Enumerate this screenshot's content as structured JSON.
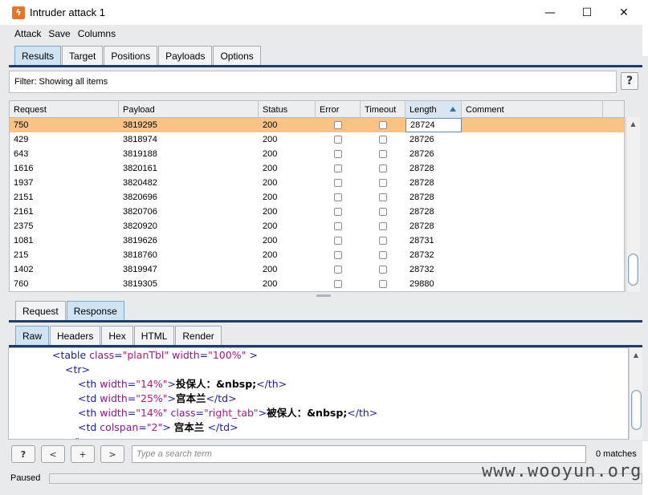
{
  "window": {
    "title": "Intruder attack 1",
    "controls": {
      "minimize": "—",
      "maximize": "☐",
      "close": "✕"
    }
  },
  "menu": [
    "Attack",
    "Save",
    "Columns"
  ],
  "main_tabs": [
    {
      "label": "Results",
      "active": true
    },
    {
      "label": "Target",
      "active": false
    },
    {
      "label": "Positions",
      "active": false
    },
    {
      "label": "Payloads",
      "active": false
    },
    {
      "label": "Options",
      "active": false
    }
  ],
  "filter": {
    "text": "Filter:  Showing all items",
    "help": "?"
  },
  "results_table": {
    "columns": [
      "Request",
      "Payload",
      "Status",
      "Error",
      "Timeout",
      "Length",
      "Comment"
    ],
    "sorted_column": "Length",
    "selected_row": 0,
    "rows": [
      {
        "request": "750",
        "payload": "3819295",
        "status": "200",
        "length": "28724"
      },
      {
        "request": "429",
        "payload": "3818974",
        "status": "200",
        "length": "28726"
      },
      {
        "request": "643",
        "payload": "3819188",
        "status": "200",
        "length": "28726"
      },
      {
        "request": "1616",
        "payload": "3820161",
        "status": "200",
        "length": "28728"
      },
      {
        "request": "1937",
        "payload": "3820482",
        "status": "200",
        "length": "28728"
      },
      {
        "request": "2151",
        "payload": "3820696",
        "status": "200",
        "length": "28728"
      },
      {
        "request": "2161",
        "payload": "3820706",
        "status": "200",
        "length": "28728"
      },
      {
        "request": "2375",
        "payload": "3820920",
        "status": "200",
        "length": "28728"
      },
      {
        "request": "1081",
        "payload": "3819626",
        "status": "200",
        "length": "28731"
      },
      {
        "request": "215",
        "payload": "3818760",
        "status": "200",
        "length": "28732"
      },
      {
        "request": "1402",
        "payload": "3819947",
        "status": "200",
        "length": "28732"
      },
      {
        "request": "760",
        "payload": "3819305",
        "status": "200",
        "length": "29880"
      }
    ]
  },
  "detail_tabs": [
    {
      "label": "Request",
      "active": false
    },
    {
      "label": "Response",
      "active": true
    }
  ],
  "view_tabs": [
    {
      "label": "Raw",
      "active": true
    },
    {
      "label": "Headers",
      "active": false
    },
    {
      "label": "Hex",
      "active": false
    },
    {
      "label": "HTML",
      "active": false
    },
    {
      "label": "Render",
      "active": false
    }
  ],
  "code_lines": [
    {
      "indent": 54,
      "tokens": [
        [
          "tg",
          "<table "
        ],
        [
          "an",
          "class"
        ],
        [
          "tg",
          "="
        ],
        [
          "av",
          "\"planTbl\""
        ],
        [
          "tg",
          " "
        ],
        [
          "an",
          "width"
        ],
        [
          "tg",
          "="
        ],
        [
          "av",
          "\"100%\""
        ],
        [
          "tg",
          " >"
        ]
      ]
    },
    {
      "indent": 70,
      "tokens": [
        [
          "tg",
          "<tr>"
        ]
      ]
    },
    {
      "indent": 86,
      "tokens": [
        [
          "tg",
          "<th "
        ],
        [
          "an",
          "width"
        ],
        [
          "tg",
          "="
        ],
        [
          "av",
          "\"14%\""
        ],
        [
          "tg",
          ">"
        ],
        [
          "tx",
          "投保人：&nbsp;"
        ],
        [
          "tg",
          "</th>"
        ]
      ]
    },
    {
      "indent": 86,
      "tokens": [
        [
          "tg",
          "<td "
        ],
        [
          "an",
          "width"
        ],
        [
          "tg",
          "="
        ],
        [
          "av",
          "\"25%\""
        ],
        [
          "tg",
          ">"
        ],
        [
          "tx",
          "宫本兰"
        ],
        [
          "tg",
          "</td>"
        ]
      ]
    },
    {
      "indent": 86,
      "tokens": [
        [
          "tg",
          "<th "
        ],
        [
          "an",
          "width"
        ],
        [
          "tg",
          "="
        ],
        [
          "av",
          "\"14%\""
        ],
        [
          "tg",
          " "
        ],
        [
          "an",
          "class"
        ],
        [
          "tg",
          "="
        ],
        [
          "av",
          "\"right_tab\""
        ],
        [
          "tg",
          ">"
        ],
        [
          "tx",
          "被保人：&nbsp;"
        ],
        [
          "tg",
          "</th>"
        ]
      ]
    },
    {
      "indent": 86,
      "tokens": [
        [
          "tg",
          "<td "
        ],
        [
          "an",
          "colspan"
        ],
        [
          "tg",
          "="
        ],
        [
          "av",
          "\"2\""
        ],
        [
          "tg",
          "> "
        ],
        [
          "tx",
          "宫本兰 "
        ],
        [
          "tg",
          "</td>"
        ]
      ]
    },
    {
      "indent": 70,
      "tokens": [
        [
          "tg",
          "</tr>"
        ]
      ]
    }
  ],
  "nav_buttons": {
    "help": "?",
    "prev": "<",
    "add": "+",
    "next": ">"
  },
  "search": {
    "placeholder": "Type a search term"
  },
  "matches": "0 matches",
  "status": "Paused",
  "watermark": "www.wooyun.org",
  "colors": {
    "selected_row": "#f8c384",
    "active_tab": "#cfe3f3",
    "tab_underline": "#1d3c6e",
    "accent_icon": "#e8742a"
  }
}
